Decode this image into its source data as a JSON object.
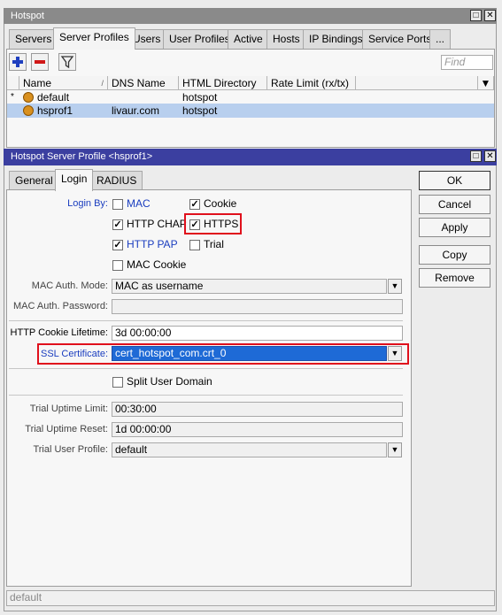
{
  "outer_window": {
    "title": "Hotspot"
  },
  "tabs": [
    "Servers",
    "Server Profiles",
    "Users",
    "User Profiles",
    "Active",
    "Hosts",
    "IP Bindings",
    "Service Ports",
    "..."
  ],
  "toolbar": {
    "find_placeholder": "Find"
  },
  "table": {
    "columns": [
      "Name",
      "DNS Name",
      "HTML Directory",
      "Rate Limit (rx/tx)"
    ],
    "rows": [
      {
        "marker": "*",
        "name": "default",
        "dns": "",
        "html_dir": "hotspot",
        "rate": ""
      },
      {
        "marker": "",
        "name": "hsprof1",
        "dns": "livaur.com",
        "html_dir": "hotspot",
        "rate": ""
      }
    ]
  },
  "dialog": {
    "title": "Hotspot Server Profile <hsprof1>",
    "tabs": [
      "General",
      "Login",
      "RADIUS"
    ],
    "login_by_label": "Login By:",
    "options": {
      "mac": {
        "label": "MAC",
        "checked": false
      },
      "cookie": {
        "label": "Cookie",
        "checked": true
      },
      "http_chap": {
        "label": "HTTP CHAP",
        "checked": true
      },
      "https": {
        "label": "HTTPS",
        "checked": true
      },
      "http_pap": {
        "label": "HTTP PAP",
        "checked": true
      },
      "trial": {
        "label": "Trial",
        "checked": false
      },
      "mac_cookie": {
        "label": "MAC Cookie",
        "checked": false
      }
    },
    "mac_auth_mode": {
      "label": "MAC Auth. Mode:",
      "value": "MAC as username"
    },
    "mac_auth_password": {
      "label": "MAC Auth. Password:",
      "value": ""
    },
    "http_cookie_lifetime": {
      "label": "HTTP Cookie Lifetime:",
      "value": "3d 00:00:00"
    },
    "ssl_certificate": {
      "label": "SSL Certificate:",
      "value": "cert_hotspot_com.crt_0"
    },
    "split_user_domain": {
      "label": "Split User Domain",
      "checked": false
    },
    "trial_uptime_limit": {
      "label": "Trial Uptime Limit:",
      "value": "00:30:00"
    },
    "trial_uptime_reset": {
      "label": "Trial Uptime Reset:",
      "value": "1d 00:00:00"
    },
    "trial_user_profile": {
      "label": "Trial User Profile:",
      "value": "default"
    },
    "buttons": {
      "ok": "OK",
      "cancel": "Cancel",
      "apply": "Apply",
      "copy": "Copy",
      "remove": "Remove"
    },
    "status": "default"
  },
  "colors": {
    "highlight": "#e0101c",
    "selected_field": "#1e6ad6",
    "dialog_title": "#3b3fa0"
  }
}
